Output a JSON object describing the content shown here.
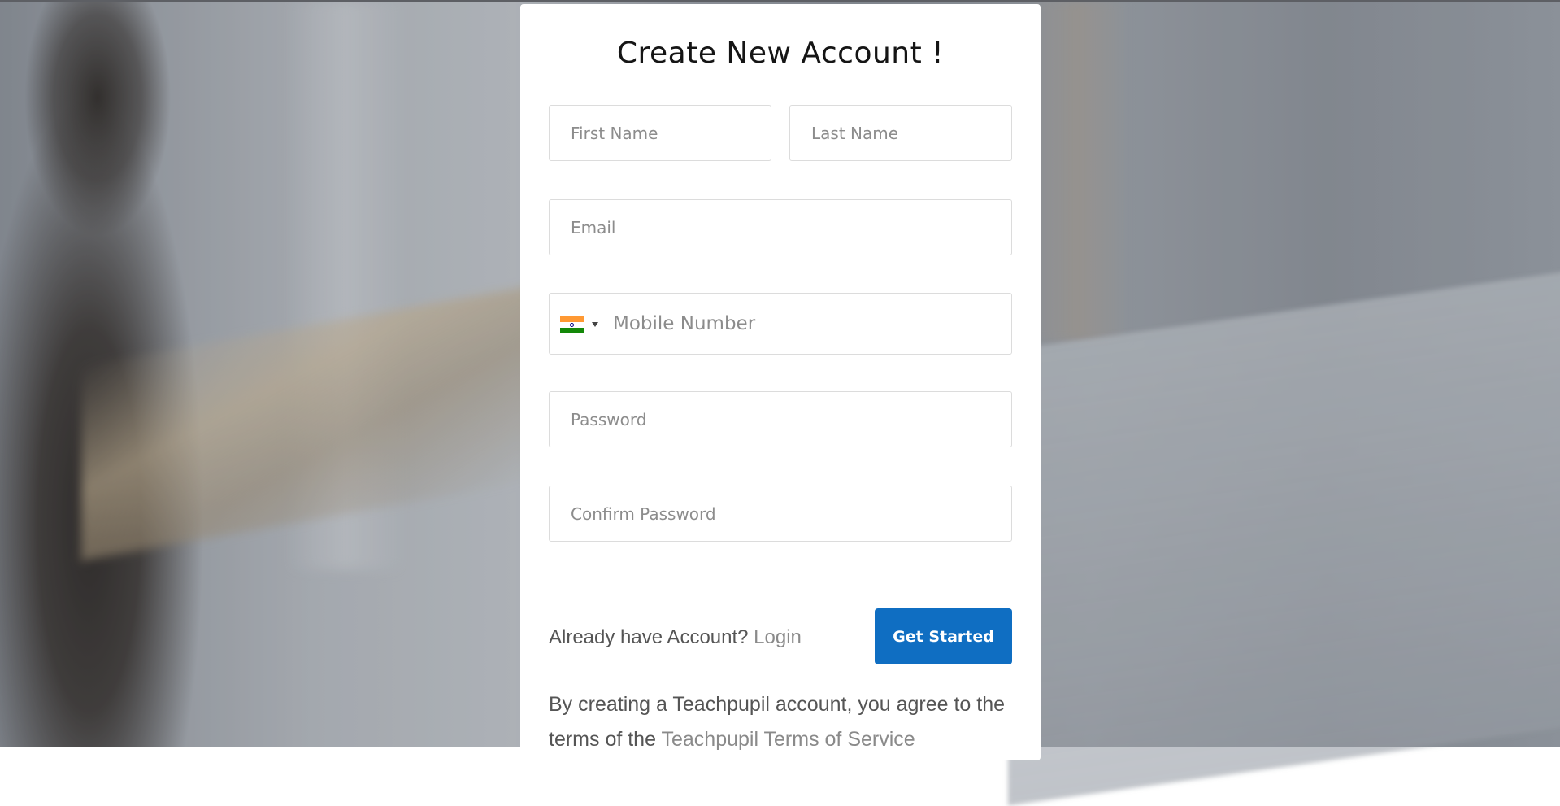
{
  "form": {
    "title": "Create New Account !",
    "first_name_placeholder": "First Name",
    "last_name_placeholder": "Last Name",
    "email_placeholder": "Email",
    "mobile_placeholder": "Mobile Number",
    "country_flag": "india-flag-icon",
    "password_placeholder": "Password",
    "confirm_password_placeholder": "Confirm Password"
  },
  "footer": {
    "login_prompt": "Already have Account? ",
    "login_link": "Login",
    "get_started_label": "Get Started",
    "terms_text": "By creating a Teachpupil account, you agree to the terms of the ",
    "terms_link": "Teachpupil Terms of Service"
  },
  "colors": {
    "primary_button": "#0f6ec2",
    "link": "#8a8a8a",
    "text": "#555555",
    "title": "#151515"
  }
}
